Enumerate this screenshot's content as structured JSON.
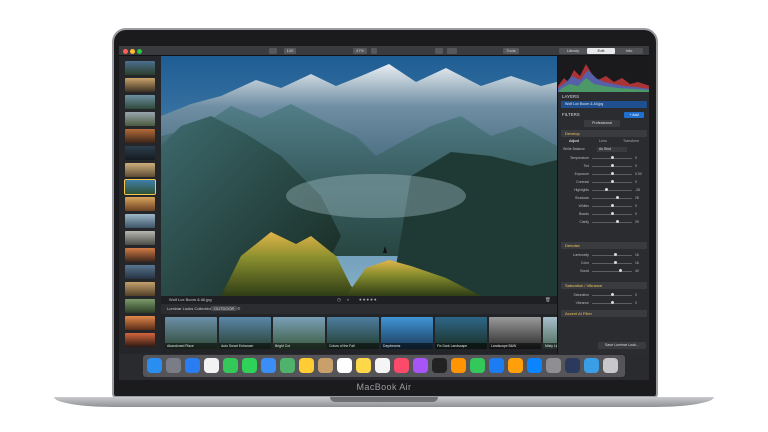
{
  "device": {
    "model_label": "MacBook Air"
  },
  "toolbar": {
    "zoom": "100",
    "zoom_percent": "47%",
    "tools_label": "Tools",
    "tabs": [
      "Library",
      "Edit",
      "Info"
    ],
    "active_tab": "Edit"
  },
  "image": {
    "filename": "Wolf Lox Boom & All.jpg"
  },
  "looks": {
    "panel_title": "Luminar Looks Collection",
    "collection": "OUTDOOR",
    "items": [
      {
        "label": "Abandoned Place"
      },
      {
        "label": "Auto Smart Enhancer"
      },
      {
        "label": "Bright Cut"
      },
      {
        "label": "Colors of the Fall"
      },
      {
        "label": "Daydreams"
      },
      {
        "label": "Fix Dark Landscape"
      },
      {
        "label": "Landscape B&W"
      },
      {
        "label": "Misty Light"
      }
    ]
  },
  "panel": {
    "layers_label": "LAYERS",
    "layer_name": "Wolf Lox Boom & All.jpg",
    "filters_label": "FILTERS",
    "filters_button": "Professional",
    "add_filters": "+ Add",
    "develop": {
      "title": "Develop",
      "tabs": [
        "Adjust",
        "Lens",
        "Transform"
      ],
      "white_balance_label": "White Balance",
      "white_balance_value": "As Shot",
      "sliders": [
        {
          "label": "Temperature",
          "value": "0"
        },
        {
          "label": "Tint",
          "value": "0"
        },
        {
          "label": "Exposure",
          "value": "0.00"
        },
        {
          "label": "Contrast",
          "value": "0"
        },
        {
          "label": "Highlights",
          "value": "-28"
        },
        {
          "label": "Shadows",
          "value": "28"
        },
        {
          "label": "Whites",
          "value": "0"
        },
        {
          "label": "Blacks",
          "value": "0"
        },
        {
          "label": "Clarity",
          "value": "29"
        }
      ]
    },
    "denoise": {
      "title": "Denoise",
      "sliders": [
        {
          "label": "Luminosity",
          "value": "16"
        },
        {
          "label": "Color",
          "value": "16"
        },
        {
          "label": "Boost",
          "value": "40"
        }
      ]
    },
    "saturation": {
      "title": "Saturation / Vibrance",
      "sliders": [
        {
          "label": "Saturation",
          "value": "0"
        },
        {
          "label": "Vibrance",
          "value": "0"
        }
      ]
    },
    "accent": {
      "title": "Accent AI Filter"
    },
    "save_button": "Save Luminar Look..."
  },
  "dock": {
    "apps": [
      "finder-icon",
      "launchpad-icon",
      "safari-icon",
      "photos-icon",
      "messages-icon",
      "facetime-icon",
      "mail-icon",
      "maps-icon",
      "photos-app-icon",
      "contacts-icon",
      "calendar-icon",
      "notes-icon",
      "reminders-icon",
      "music-icon",
      "podcasts-icon",
      "tv-icon",
      "books-icon",
      "numbers-icon",
      "keynote-icon",
      "pages-icon",
      "app-store-icon",
      "system-preferences-icon",
      "luminar-icon",
      "downloads-icon",
      "trash-icon"
    ]
  },
  "colors": {
    "accent": "#f0c35a",
    "selection": "#1f6fd1"
  }
}
